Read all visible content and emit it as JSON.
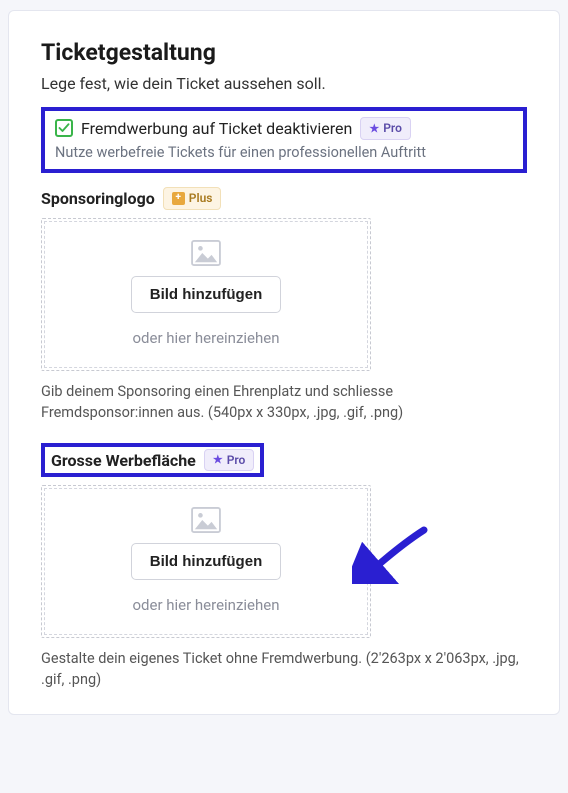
{
  "page": {
    "title": "Ticketgestaltung",
    "subtitle": "Lege fest, wie dein Ticket aussehen soll."
  },
  "option": {
    "label": "Fremdwerbung auf Ticket deaktivieren",
    "badge": "Pro",
    "desc": "Nutze werbefreie Tickets für einen professionellen Auftritt"
  },
  "sponsoring": {
    "label": "Sponsoringlogo",
    "badge": "Plus",
    "add_button": "Bild hinzufügen",
    "drop_hint": "oder hier hereinziehen",
    "help": "Gib deinem Sponsoring einen Ehrenplatz und schliesse Fremdsponsor:innen aus. (540px x 330px, .jpg, .gif, .png)"
  },
  "adspace": {
    "label": "Grosse Werbefläche",
    "badge": "Pro",
    "add_button": "Bild hinzufügen",
    "drop_hint": "oder hier hereinziehen",
    "help": "Gestalte dein eigenes Ticket ohne Fremdwerbung. (2'263px x 2'063px, .jpg, .gif, .png)"
  }
}
